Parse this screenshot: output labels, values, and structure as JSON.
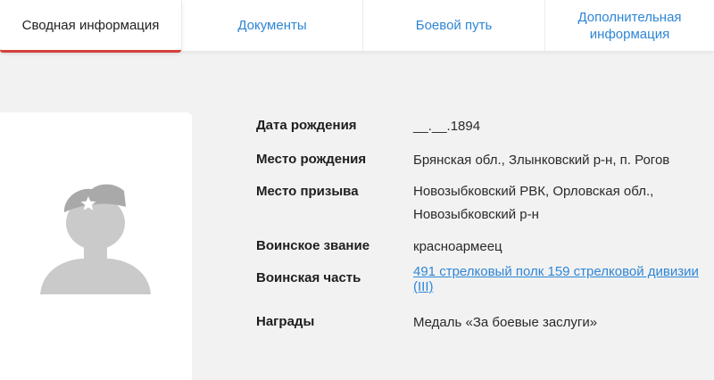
{
  "tabs": [
    {
      "label": "Сводная информация",
      "active": true
    },
    {
      "label": "Документы",
      "active": false
    },
    {
      "label": "Боевой путь",
      "active": false
    },
    {
      "label": "Дополнительная информация",
      "active": false
    }
  ],
  "colors": {
    "accent": "#2e86d6",
    "active_underline": "#d6403b",
    "background": "#f2f2f2",
    "avatar": "#c8c8c8"
  },
  "avatar": {
    "icon": "soldier-silhouette-icon"
  },
  "info": {
    "birth_date": {
      "label": "Дата рождения",
      "value": "__.__.1894"
    },
    "birth_place": {
      "label": "Место рождения",
      "value": "Брянская обл., Злынковский р-н, п. Рогов"
    },
    "draft_place": {
      "label": "Место призыва",
      "value": "Новозыбковский РВК, Орловская обл., Новозыбковский р-н"
    },
    "rank": {
      "label": "Воинское звание",
      "value": "красноармеец"
    },
    "unit": {
      "label": "Воинская часть",
      "value": "491 стрелковый полк 159 стрелковой дивизии (III)"
    },
    "awards": {
      "label": "Награды",
      "value": "Медаль «За боевые заслуги»"
    }
  }
}
